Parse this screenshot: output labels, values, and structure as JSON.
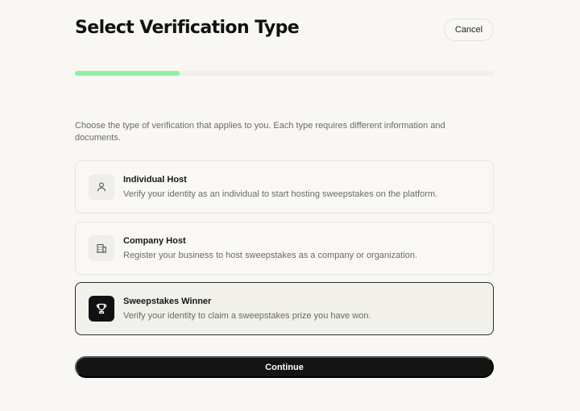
{
  "header": {
    "title": "Select Verification Type",
    "cancel_label": "Cancel"
  },
  "progress": {
    "value": 0.25,
    "color": "#8ff0a4"
  },
  "intro": "Choose the type of verification that applies to you. Each type requires different information and documents.",
  "options": [
    {
      "icon": "user-icon",
      "title": "Individual Host",
      "description": "Verify your identity as an individual to start hosting sweepstakes on the platform.",
      "selected": false
    },
    {
      "icon": "building-icon",
      "title": "Company Host",
      "description": "Register your business to host sweepstakes as a company or organization.",
      "selected": false
    },
    {
      "icon": "trophy-icon",
      "title": "Sweepstakes Winner",
      "description": "Verify your identity to claim a sweepstakes prize you have won.",
      "selected": true
    }
  ],
  "footer": {
    "continue_label": "Continue"
  }
}
